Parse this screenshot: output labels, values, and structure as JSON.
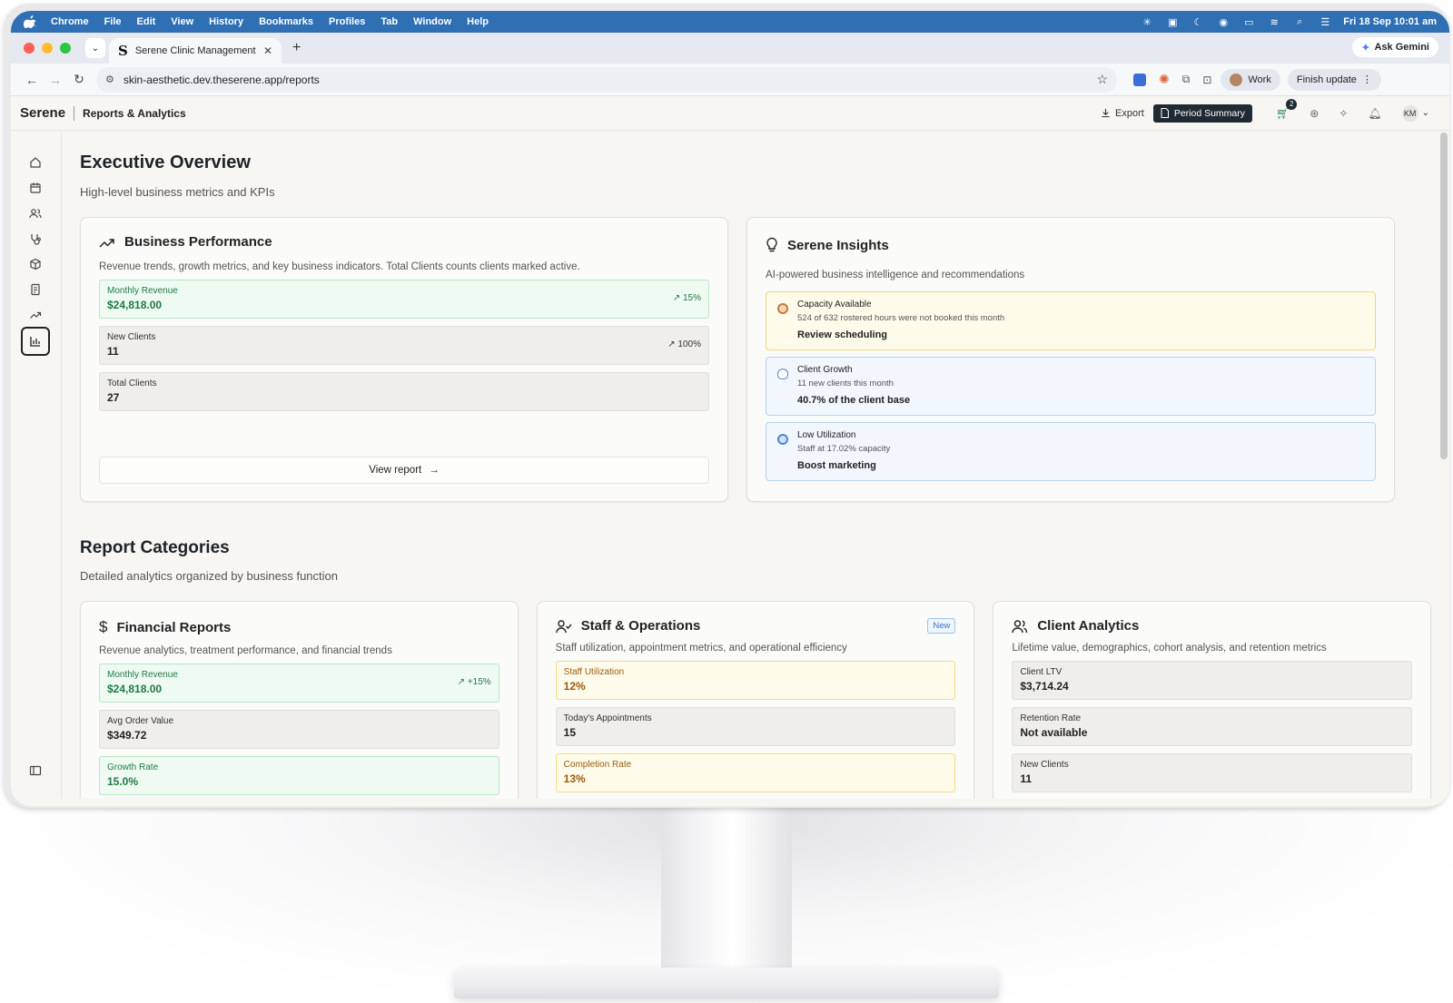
{
  "menubar": {
    "app": "Chrome",
    "items": [
      "File",
      "Edit",
      "View",
      "History",
      "Bookmarks",
      "Profiles",
      "Tab",
      "Window",
      "Help"
    ],
    "datetime": "Fri 18 Sep  10:01 am"
  },
  "browser": {
    "tab_title": "Serene Clinic Management",
    "tab_favicon": "S",
    "url": "skin-aesthetic.dev.theserene.app/reports",
    "gemini_label": "Ask Gemini",
    "profile_label": "Work",
    "update_label": "Finish update"
  },
  "header": {
    "brand": "Serene",
    "breadcrumb": "Reports & Analytics",
    "export_label": "Export",
    "period_summary_label": "Period Summary",
    "cart_count": "2",
    "user_initials": "KM"
  },
  "page": {
    "title": "Executive Overview",
    "subtitle": "High-level business metrics and KPIs"
  },
  "business_performance": {
    "title": "Business Performance",
    "description": "Revenue trends, growth metrics, and key business indicators. Total Clients counts clients marked active.",
    "metrics": [
      {
        "label": "Monthly Revenue",
        "value": "$24,818.00",
        "trend": "15%"
      },
      {
        "label": "New Clients",
        "value": "11",
        "trend": "100%"
      },
      {
        "label": "Total Clients",
        "value": "27"
      }
    ],
    "view_report_label": "View report"
  },
  "insights": {
    "title": "Serene Insights",
    "description": "AI-powered business intelligence and recommendations",
    "items": [
      {
        "title": "Capacity Available",
        "detail": "524 of 632 rostered hours were not booked this month",
        "action": "Review scheduling"
      },
      {
        "title": "Client Growth",
        "detail": "11 new clients this month",
        "action": "40.7% of the client base"
      },
      {
        "title": "Low Utilization",
        "detail": "Staff at 17.02% capacity",
        "action": "Boost marketing"
      }
    ]
  },
  "categories": {
    "title": "Report Categories",
    "subtitle": "Detailed analytics organized by business function",
    "financial": {
      "title": "Financial Reports",
      "description": "Revenue analytics, treatment performance, and financial trends",
      "metrics": [
        {
          "label": "Monthly Revenue",
          "value": "$24,818.00",
          "trend": "+15%"
        },
        {
          "label": "Avg Order Value",
          "value": "$349.72"
        },
        {
          "label": "Growth Rate",
          "value": "15.0%"
        }
      ]
    },
    "staff": {
      "title": "Staff & Operations",
      "badge": "New",
      "description": "Staff utilization, appointment metrics, and operational efficiency",
      "metrics": [
        {
          "label": "Staff Utilization",
          "value": "12%"
        },
        {
          "label": "Today's Appointments",
          "value": "15"
        },
        {
          "label": "Completion Rate",
          "value": "13%"
        }
      ]
    },
    "client": {
      "title": "Client Analytics",
      "description": "Lifetime value, demographics, cohort analysis, and retention metrics",
      "metrics": [
        {
          "label": "Client LTV",
          "value": "$3,714.24"
        },
        {
          "label": "Retention Rate",
          "value": "Not available"
        },
        {
          "label": "New Clients",
          "value": "11"
        }
      ]
    }
  },
  "colors": {
    "menubar": "#2f6fb4",
    "positive": "#1f7a43",
    "warning": "#9a5a10",
    "info": "#3b72c4"
  }
}
